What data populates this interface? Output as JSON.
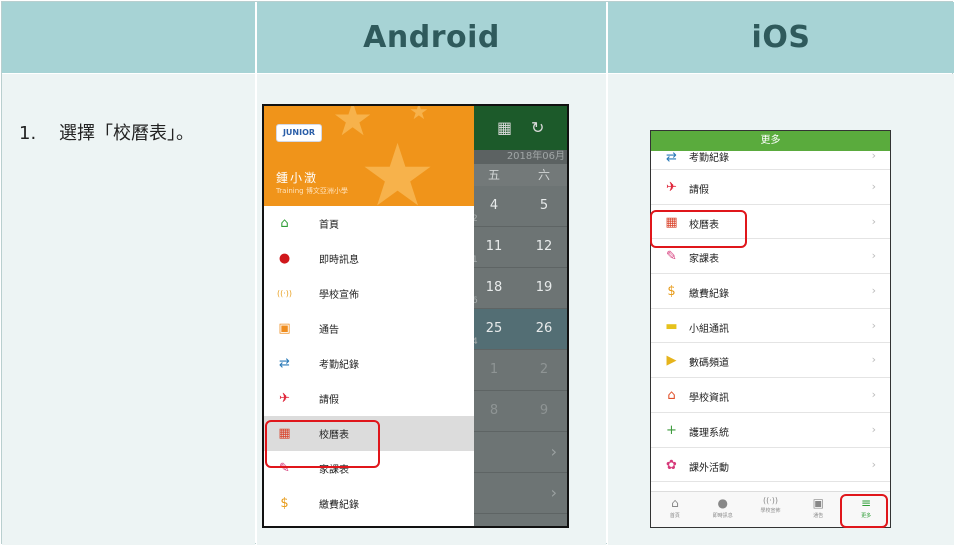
{
  "table": {
    "headers": [
      "",
      "Android",
      "iOS"
    ],
    "step_number": "1.",
    "step_text": "選擇「校曆表」。"
  },
  "android": {
    "logo_text": "JUNIOR",
    "user_name": "鍾小澂",
    "school": "Training 博文亞洲小學",
    "calendar": {
      "year_label": "2018年06月",
      "weekdays": [
        "五",
        "六"
      ],
      "weeks": [
        {
          "days": [
            "4",
            "5"
          ],
          "sub": "2"
        },
        {
          "days": [
            "11",
            "12"
          ],
          "sub": "1"
        },
        {
          "days": [
            "18",
            "19"
          ],
          "sub": "6"
        },
        {
          "days": [
            "25",
            "26"
          ],
          "sub": "4"
        },
        {
          "days": [
            "1",
            "2"
          ],
          "sub": ""
        },
        {
          "days": [
            "8",
            "9"
          ],
          "sub": ""
        }
      ]
    },
    "menu": [
      {
        "label": "首頁",
        "icon": "home-icon",
        "color": "#2e9e36",
        "glyph": "⌂"
      },
      {
        "label": "即時訊息",
        "icon": "message-icon",
        "color": "#d0171b",
        "glyph": "●"
      },
      {
        "label": "學校宣佈",
        "icon": "broadcast-icon",
        "color": "#e8a020",
        "glyph": "((·))"
      },
      {
        "label": "通告",
        "icon": "notice-icon",
        "color": "#ef8d1f",
        "glyph": "▣"
      },
      {
        "label": "考勤紀錄",
        "icon": "attendance-icon",
        "color": "#2a7ab8",
        "glyph": "⇄"
      },
      {
        "label": "請假",
        "icon": "leave-icon",
        "color": "#e0283c",
        "glyph": "✈"
      },
      {
        "label": "校曆表",
        "icon": "calendar-icon",
        "color": "#d9422a",
        "glyph": "▦"
      },
      {
        "label": "家課表",
        "icon": "homework-icon",
        "color": "#d63a7a",
        "glyph": "✎"
      },
      {
        "label": "繳費紀錄",
        "icon": "payment-icon",
        "color": "#e79a17",
        "glyph": "$"
      }
    ]
  },
  "ios": {
    "title": "更多",
    "menu": [
      {
        "label": "考勤紀錄",
        "icon": "attendance-icon",
        "color": "#2a7ab8",
        "glyph": "⇄"
      },
      {
        "label": "請假",
        "icon": "leave-icon",
        "color": "#e0283c",
        "glyph": "✈"
      },
      {
        "label": "校曆表",
        "icon": "calendar-icon",
        "color": "#d9422a",
        "glyph": "▦"
      },
      {
        "label": "家課表",
        "icon": "homework-icon",
        "color": "#d63a7a",
        "glyph": "✎"
      },
      {
        "label": "繳費紀錄",
        "icon": "payment-icon",
        "color": "#e79a17",
        "glyph": "$"
      },
      {
        "label": "小組通訊",
        "icon": "group-icon",
        "color": "#e6c21c",
        "glyph": "▬"
      },
      {
        "label": "數碼頻道",
        "icon": "digital-channel-icon",
        "color": "#e6b41c",
        "glyph": "▶"
      },
      {
        "label": "學校資訊",
        "icon": "school-info-icon",
        "color": "#e0502a",
        "glyph": "⌂"
      },
      {
        "label": "護理系統",
        "icon": "nursing-icon",
        "color": "#3d9a3d",
        "glyph": "+"
      },
      {
        "label": "課外活動",
        "icon": "activity-icon",
        "color": "#d63a7a",
        "glyph": "✿"
      }
    ],
    "tabs": [
      {
        "label": "首頁",
        "icon": "home-icon",
        "glyph": "⌂"
      },
      {
        "label": "即時訊息",
        "icon": "message-icon",
        "glyph": "●"
      },
      {
        "label": "學校宣佈",
        "icon": "broadcast-icon",
        "glyph": "((·))"
      },
      {
        "label": "通告",
        "icon": "notice-icon",
        "glyph": "▣"
      },
      {
        "label": "更多",
        "icon": "menu-icon",
        "glyph": "≡"
      }
    ]
  }
}
